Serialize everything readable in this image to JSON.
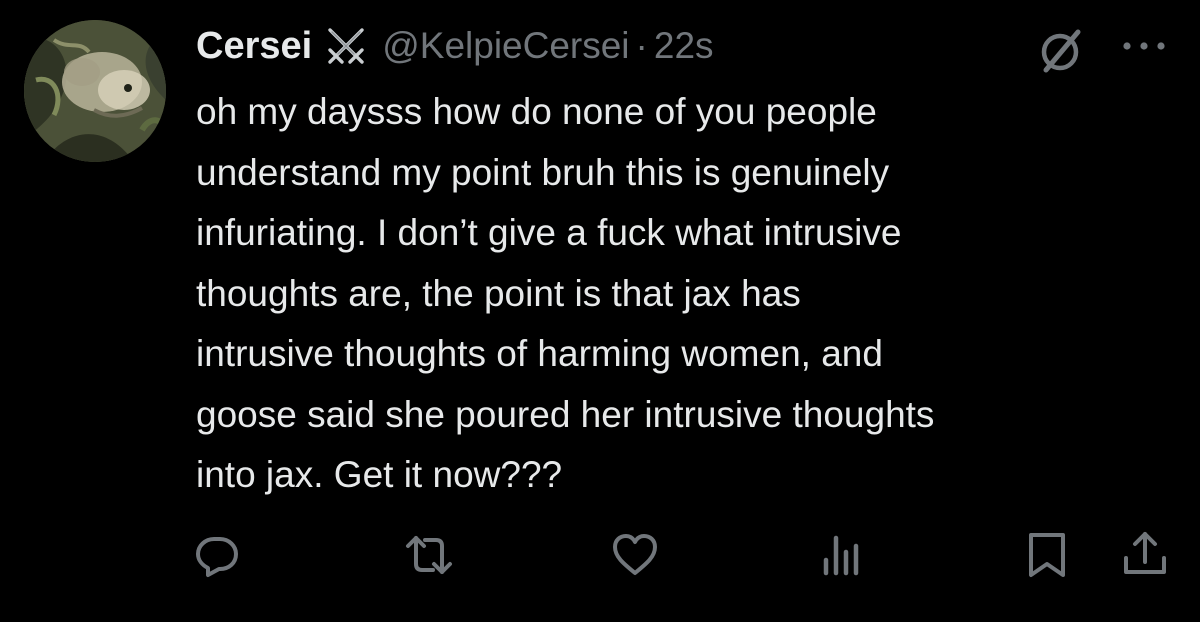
{
  "author": {
    "name": "Cersei",
    "badge_icon": "crossed-swords-icon",
    "handle": "@KelpieCersei",
    "separator": "·",
    "time": "22s"
  },
  "tweet": {
    "text": "oh my daysss how do none of you people\nunderstand my point bruh this is genuinely\ninfuriating. I don’t give a fuck what intrusive\nthoughts are, the point is that jax has\nintrusive thoughts of harming women, and\ngoose said she poured her intrusive thoughts\ninto jax. Get it now???"
  },
  "header_icons": [
    "grok-icon",
    "more-icon"
  ],
  "actions": [
    "reply-icon",
    "retweet-icon",
    "like-icon",
    "views-icon",
    "bookmark-icon",
    "share-icon"
  ],
  "colors": {
    "background": "#000000",
    "text": "#e7e9ea",
    "secondary": "#71767b"
  }
}
